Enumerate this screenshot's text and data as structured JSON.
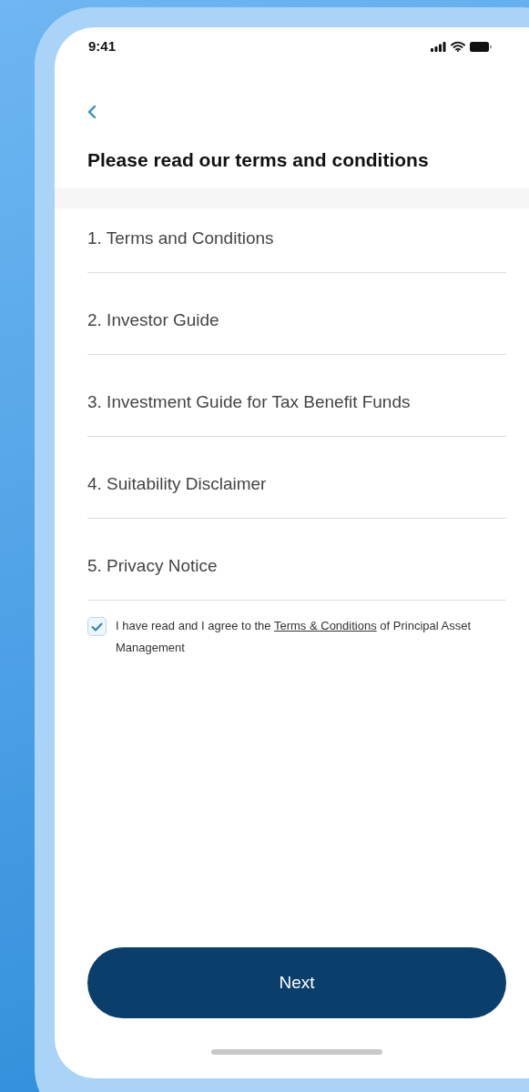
{
  "status_bar": {
    "time": "9:41"
  },
  "header": {
    "title": "Please read our terms and conditions"
  },
  "documents": [
    {
      "label": "1. Terms and Conditions"
    },
    {
      "label": "2. Investor Guide"
    },
    {
      "label": "3. Investment Guide for Tax Benefit Funds"
    },
    {
      "label": "4. Suitability Disclaimer"
    },
    {
      "label": "5. Privacy Notice"
    }
  ],
  "agreement": {
    "checked": true,
    "text_before": "I have read and I agree to the",
    "link": "Terms & Conditions",
    "text_after": "of Principal Asset Management"
  },
  "next_button": {
    "label": "Next"
  }
}
